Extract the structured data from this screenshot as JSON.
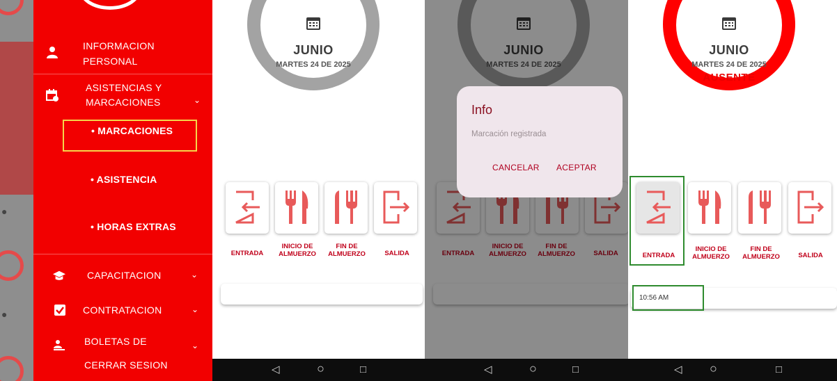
{
  "menu": {
    "items": [
      {
        "label_l1": "INFORMACION",
        "label_l2": "PERSONAL",
        "icon": "person-icon"
      },
      {
        "label_l1": "ASISTENCIAS Y",
        "label_l2": "MARCACIONES",
        "icon": "calendar-clock-icon"
      },
      {
        "label": "CAPACITACION",
        "icon": "graduation-cap-icon"
      },
      {
        "label": "CONTRATACION",
        "icon": "checkbox-icon"
      },
      {
        "label": "BOLETAS DE",
        "icon": "people-icon"
      },
      {
        "label": "CERRAR SESION"
      }
    ],
    "subitems": [
      "MARCACIONES",
      "ASISTENCIA",
      "HORAS EXTRAS"
    ]
  },
  "app": {
    "month": "JUNIO",
    "date": "MARTES 24 DE 2025",
    "status": "AUSENTE",
    "actions": [
      {
        "l1": "ENTRADA",
        "l2": ""
      },
      {
        "l1": "INICIO DE",
        "l2": "ALMUERZO"
      },
      {
        "l1": "FIN DE",
        "l2": "ALMUERZO"
      },
      {
        "l1": "SALIDA",
        "l2": ""
      }
    ],
    "entry_time": "10:56 AM"
  },
  "dialog": {
    "title": "Info",
    "message": "Marcación registrada",
    "cancel": "CANCELAR",
    "accept": "ACEPTAR"
  },
  "nav": {
    "back": "◁",
    "home": "○",
    "recent": "□"
  },
  "colors": {
    "brand_red": "#f20000",
    "accent_dark_red": "#c0001a",
    "highlight_yellow": "#f5d64a",
    "highlight_green": "#2e8b2e"
  }
}
